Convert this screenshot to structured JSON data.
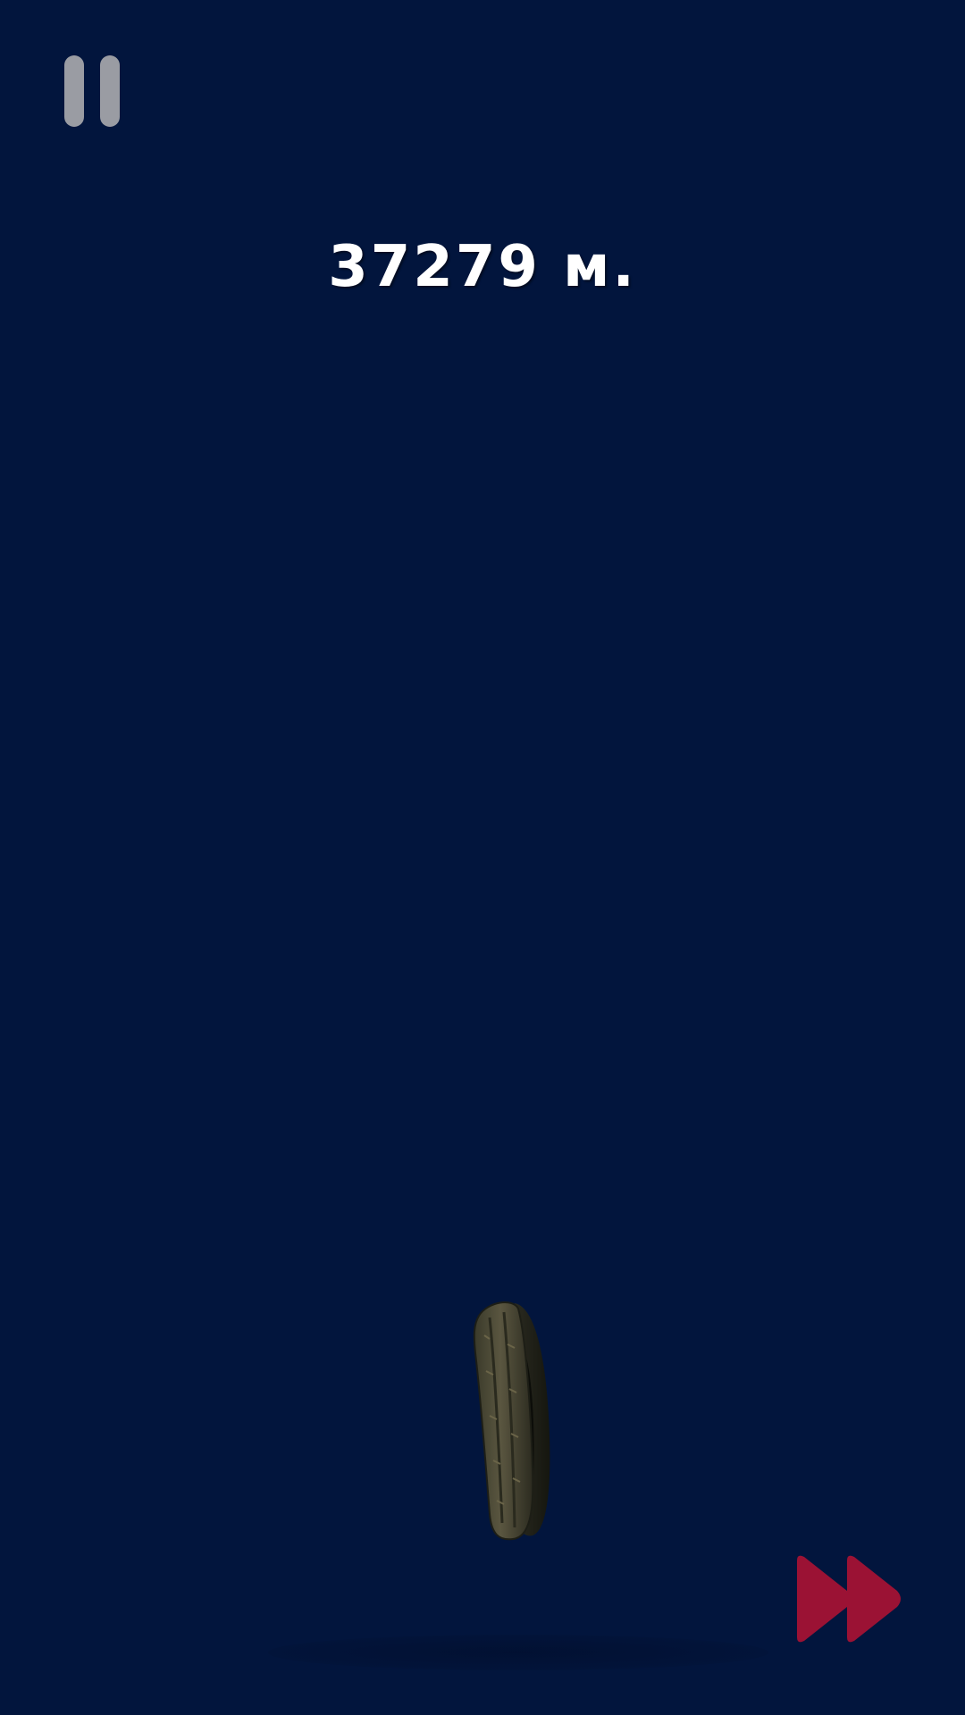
{
  "hud": {
    "distance_text": "37279 м.",
    "pause_icon": "pause-icon",
    "fast_forward_icon": "fast-forward-icon"
  },
  "colors": {
    "background": "#02153d",
    "pause": "#9a9ca3",
    "fast_forward": "#9b1234",
    "text": "#ffffff"
  }
}
